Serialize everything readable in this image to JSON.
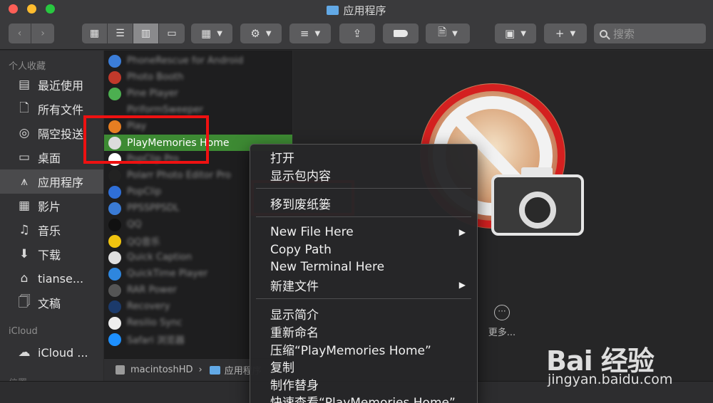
{
  "window": {
    "title": "应用程序"
  },
  "toolbar": {
    "back_icon": "chevron-left",
    "forward_icon": "chevron-right",
    "view_icons": [
      "icon-view",
      "list-view",
      "column-view",
      "gallery-view"
    ],
    "search_placeholder": "搜索"
  },
  "sidebar": {
    "favorites_header": "个人收藏",
    "favorites": [
      {
        "label": "最近使用",
        "icon": "clock-icon"
      },
      {
        "label": "所有文件",
        "icon": "file-icon"
      },
      {
        "label": "隔空投送",
        "icon": "airdrop-icon"
      },
      {
        "label": "桌面",
        "icon": "desktop-icon"
      },
      {
        "label": "应用程序",
        "icon": "apps-icon",
        "active": true
      },
      {
        "label": "影片",
        "icon": "film-icon"
      },
      {
        "label": "音乐",
        "icon": "music-icon"
      },
      {
        "label": "下载",
        "icon": "download-icon"
      },
      {
        "label": "tianse...",
        "icon": "home-icon"
      },
      {
        "label": "文稿",
        "icon": "document-icon"
      }
    ],
    "icloud_header": "iCloud",
    "icloud": [
      {
        "label": "iCloud ...",
        "icon": "cloud-icon"
      }
    ],
    "locations_header": "位置"
  },
  "files": [
    {
      "name": "PhoneRescue for Android",
      "color": "#3b7dd8"
    },
    {
      "name": "Photo Booth",
      "color": "#c0392b"
    },
    {
      "name": "Pine Player",
      "color": "#4caf50"
    },
    {
      "name": "PiriformSweeper",
      "color": "#1e1e1f"
    },
    {
      "name": "Play",
      "color": "#e67e22"
    },
    {
      "name": "PlayMemories Home",
      "color": "#dcdcdc",
      "selected": true
    },
    {
      "name": "PopClip Pro",
      "color": "#ffffff"
    },
    {
      "name": "Polarr Photo Editor Pro",
      "color": "#222222"
    },
    {
      "name": "PopClip",
      "color": "#2f6fd8"
    },
    {
      "name": "PPSSPPSDL",
      "color": "#3a7bd5"
    },
    {
      "name": "QQ",
      "color": "#111111"
    },
    {
      "name": "QQ音乐",
      "color": "#f1c40f"
    },
    {
      "name": "Quick Caption",
      "color": "#e0e0e0"
    },
    {
      "name": "QuickTime Player",
      "color": "#2e86de"
    },
    {
      "name": "RAR Power",
      "color": "#555555"
    },
    {
      "name": "Recovery",
      "color": "#1b3a6b"
    },
    {
      "name": "Resilio Sync",
      "color": "#eeeeee"
    },
    {
      "name": "Safari 浏览器",
      "color": "#1e90ff"
    }
  ],
  "pathbar": {
    "drive": "macintoshHD",
    "sep": "›",
    "folder": "应用程序"
  },
  "preview": {
    "more_label": "更多..."
  },
  "context_menu": {
    "group1": [
      "打开",
      "显示包内容"
    ],
    "group2": [
      "移到废纸篓"
    ],
    "group3": [
      {
        "label": "New File Here",
        "submenu": true
      },
      {
        "label": "Copy Path",
        "submenu": false
      },
      {
        "label": "New Terminal Here",
        "submenu": false
      },
      {
        "label": "新建文件",
        "submenu": true
      }
    ],
    "group4": [
      "显示简介",
      "重新命名",
      "压缩“PlayMemories Home”",
      "复制",
      "制作替身",
      "快速查看“PlayMemories Home”"
    ],
    "arrow_glyph": "▶"
  },
  "watermark": {
    "brand": "Bai  经验",
    "url": "jingyan.baidu.com"
  },
  "colors": {
    "highlight_red": "#ee1111",
    "selection_green": "#3d8a33",
    "folder_blue": "#62a9e6"
  }
}
